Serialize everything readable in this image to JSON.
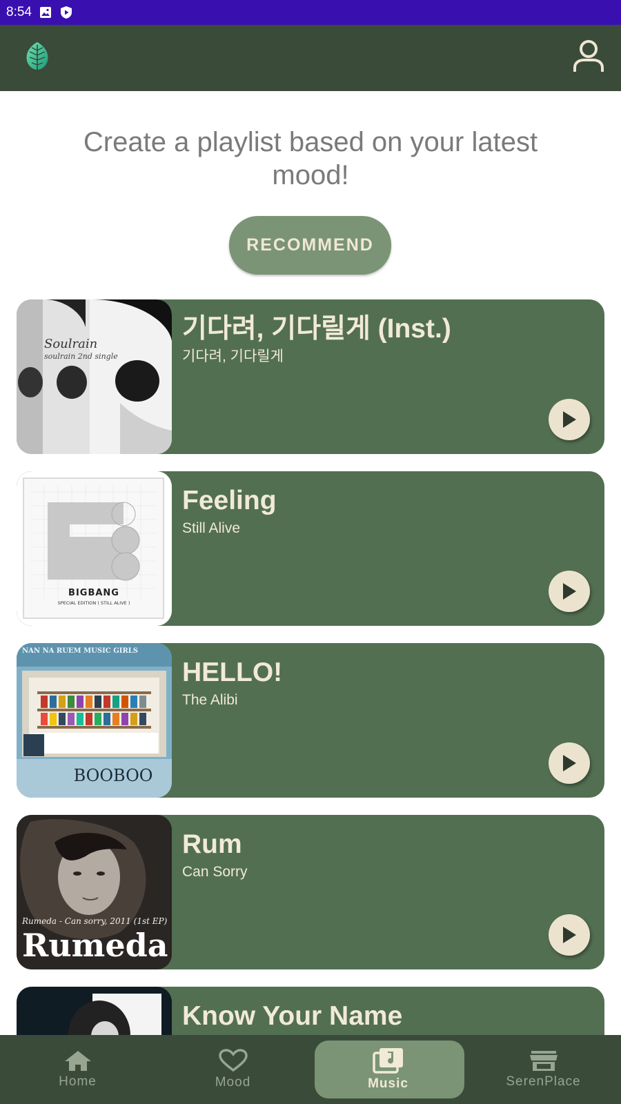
{
  "status_bar": {
    "time": "8:54",
    "icons": [
      "image-icon",
      "shield-play-icon"
    ],
    "background": "#3a0fb0"
  },
  "app_bar": {
    "logo_icon": "leaf-logo-icon",
    "profile_icon": "person-icon",
    "background": "#3b4b39"
  },
  "main": {
    "headline": "Create a playlist based on your latest mood!",
    "recommend_label": "RECOMMEND"
  },
  "tracks": [
    {
      "title": "기다려, 기다릴게 (Inst.)",
      "artist": "기다려, 기다릴게",
      "cover_text": "Soulrain",
      "cover_subtext": "soulrain 2nd single"
    },
    {
      "title": "Feeling",
      "artist": "Still Alive",
      "cover_text": "BIGBANG",
      "cover_subtext": "SPECIAL EDITION ( STILL ALIVE )"
    },
    {
      "title": "HELLO!",
      "artist": "The Alibi",
      "cover_text": "BOOBOO",
      "cover_subtext": "NAN NA RUEM MUSIC GIRLS"
    },
    {
      "title": "Rum",
      "artist": "Can Sorry",
      "cover_text": "Rumeda",
      "cover_subtext": "Rumeda - Can sorry, 2011 (1st EP)"
    },
    {
      "title": "Know Your Name",
      "artist": "",
      "cover_text": "",
      "cover_subtext": ""
    }
  ],
  "bottom_nav": {
    "items": [
      {
        "label": "Home",
        "icon": "home-icon",
        "active": false
      },
      {
        "label": "Mood",
        "icon": "heart-icon",
        "active": false
      },
      {
        "label": "Music",
        "icon": "music-library-icon",
        "active": true
      },
      {
        "label": "SerenPlace",
        "icon": "store-icon",
        "active": false
      }
    ]
  },
  "colors": {
    "card": "#526f52",
    "accent": "#7a9475",
    "text_light": "#f1ead6"
  }
}
